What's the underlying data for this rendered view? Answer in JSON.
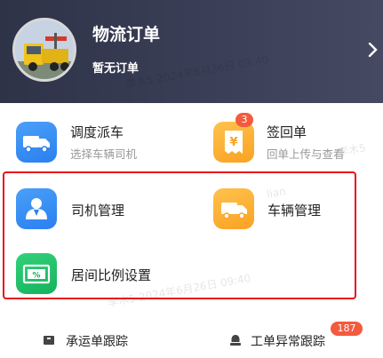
{
  "header": {
    "title": "物流订单",
    "subtitle": "暂无订单"
  },
  "grid": {
    "dispatch": {
      "label": "调度派车",
      "sub": "选择车辆司机",
      "icon": "truck-icon"
    },
    "receipt": {
      "label": "签回单",
      "sub": "回单上传与查看",
      "badge": "3",
      "icon": "receipt-yen-icon"
    },
    "driver_mgmt": {
      "label": "司机管理",
      "icon": "driver-icon"
    },
    "vehicle_mgmt": {
      "label": "车辆管理",
      "icon": "van-icon"
    },
    "ratio_settings": {
      "label": "居间比例设置",
      "icon": "percent-icon"
    }
  },
  "footer": {
    "waybill_tracking": {
      "label": "承运单跟踪",
      "icon": "box-icon"
    },
    "exception_tracking": {
      "label": "工单异常跟踪",
      "badge": "187",
      "icon": "alert-icon"
    }
  },
  "watermarks": [
    "李木5 2024年6月26日 09:40",
    "lian",
    "李木5 2024年6月26日 09:40",
    "李木5"
  ],
  "colors": {
    "header_bg": "#2e3348",
    "blue": "#2a7ff0",
    "orange": "#f9a222",
    "green": "#14b35d",
    "badge": "#f35a3e",
    "highlight": "#e8121a"
  }
}
